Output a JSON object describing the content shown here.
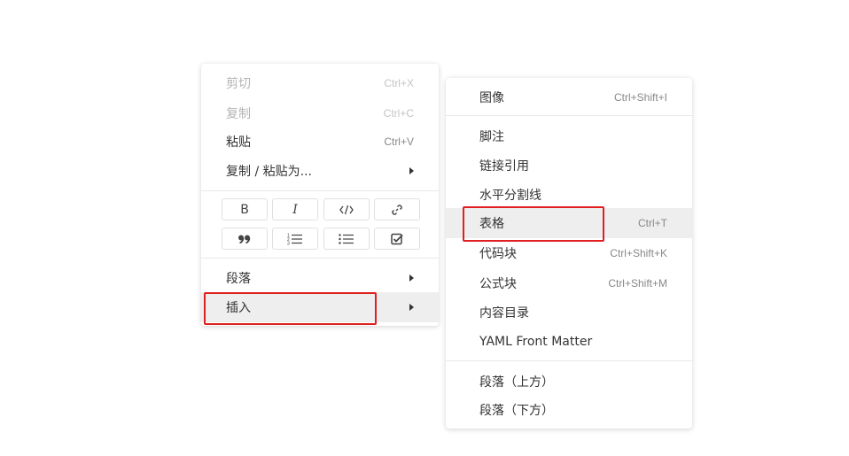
{
  "main_menu": {
    "cut": {
      "label": "剪切",
      "shortcut": "Ctrl+X"
    },
    "copy": {
      "label": "复制",
      "shortcut": "Ctrl+C"
    },
    "paste": {
      "label": "粘贴",
      "shortcut": "Ctrl+V"
    },
    "copy_paste_as": {
      "label": "复制 / 粘贴为..."
    },
    "format_buttons": {
      "bold": "B",
      "italic": "I",
      "code": "code-icon",
      "link": "link-icon",
      "quote": "quote-icon",
      "ordered_list": "ordered-list-icon",
      "unordered_list": "unordered-list-icon",
      "task_list": "checkbox-icon"
    },
    "paragraph": {
      "label": "段落"
    },
    "insert": {
      "label": "插入"
    }
  },
  "insert_menu": {
    "image": {
      "label": "图像",
      "shortcut": "Ctrl+Shift+I"
    },
    "footnote": {
      "label": "脚注"
    },
    "link_reference": {
      "label": "链接引用"
    },
    "horizontal_rule": {
      "label": "水平分割线"
    },
    "table": {
      "label": "表格",
      "shortcut": "Ctrl+T"
    },
    "code_block": {
      "label": "代码块",
      "shortcut": "Ctrl+Shift+K"
    },
    "math_block": {
      "label": "公式块",
      "shortcut": "Ctrl+Shift+M"
    },
    "toc": {
      "label": "内容目录"
    },
    "yaml": {
      "label": "YAML Front Matter"
    },
    "paragraph_above": {
      "label": "段落（上方）"
    },
    "paragraph_below": {
      "label": "段落（下方）"
    }
  },
  "colors": {
    "highlight": "#e02020",
    "hover_bg": "#eeeeee"
  }
}
